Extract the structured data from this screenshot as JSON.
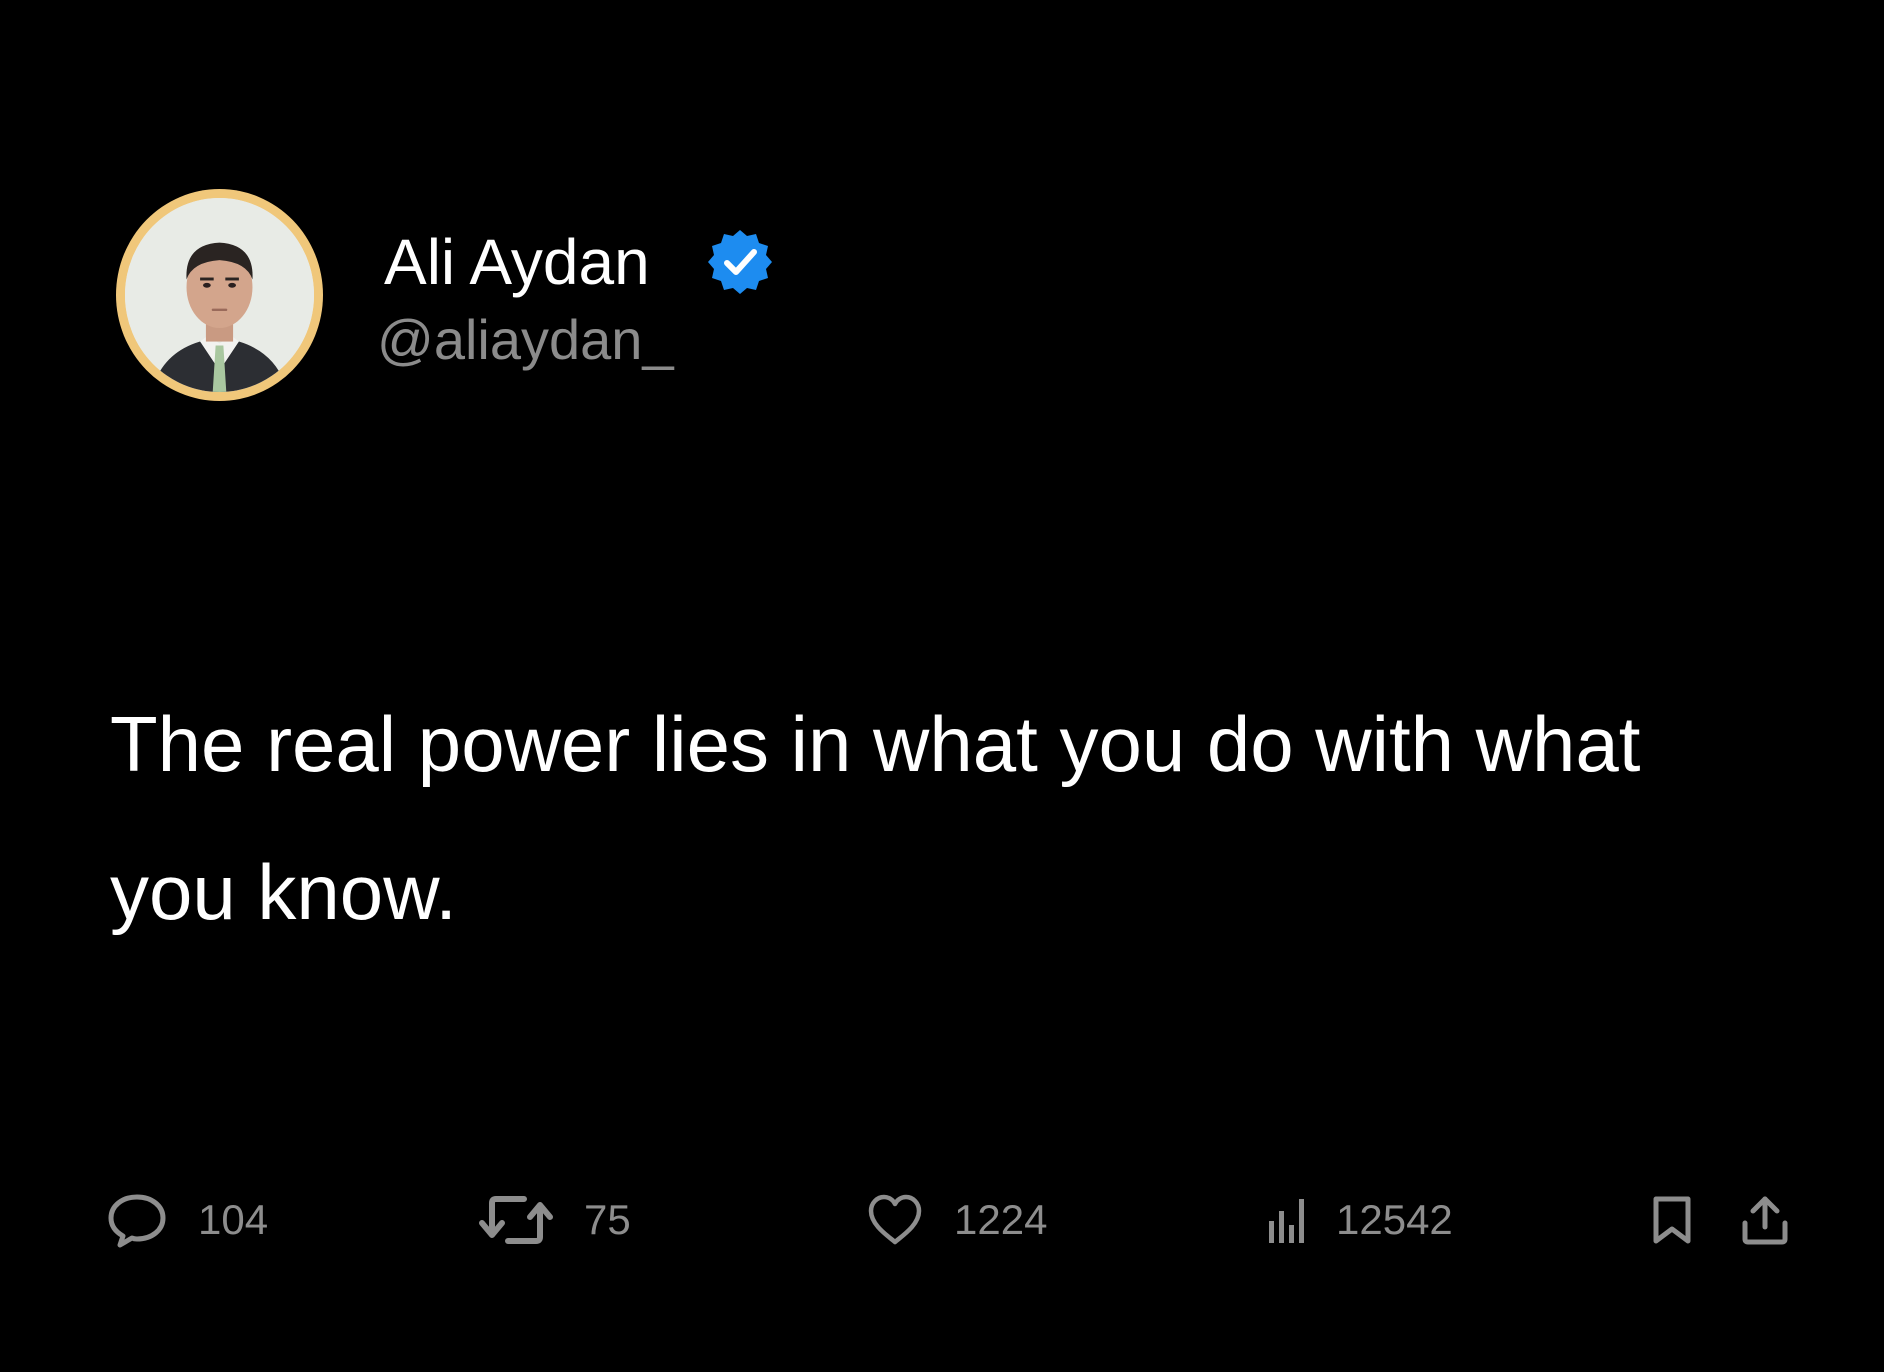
{
  "user": {
    "display_name": "Ali Aydan",
    "handle": "@aliaydan_",
    "verified_icon": "verified-badge-icon",
    "avatar_ring_color": "#f0c77a",
    "verified_color": "#1d8cf0"
  },
  "tweet": {
    "text": "The real power lies in what you do with what you know."
  },
  "actions": {
    "replies": {
      "icon": "reply-icon",
      "count": "104"
    },
    "retweets": {
      "icon": "retweet-icon",
      "count": "75"
    },
    "likes": {
      "icon": "heart-icon",
      "count": "1224"
    },
    "views": {
      "icon": "views-chart-icon",
      "count": "12542"
    },
    "bookmark": {
      "icon": "bookmark-icon"
    },
    "share": {
      "icon": "share-icon"
    }
  },
  "colors": {
    "background": "#000000",
    "primary_text": "#ffffff",
    "secondary_text": "#8b8b8b"
  }
}
